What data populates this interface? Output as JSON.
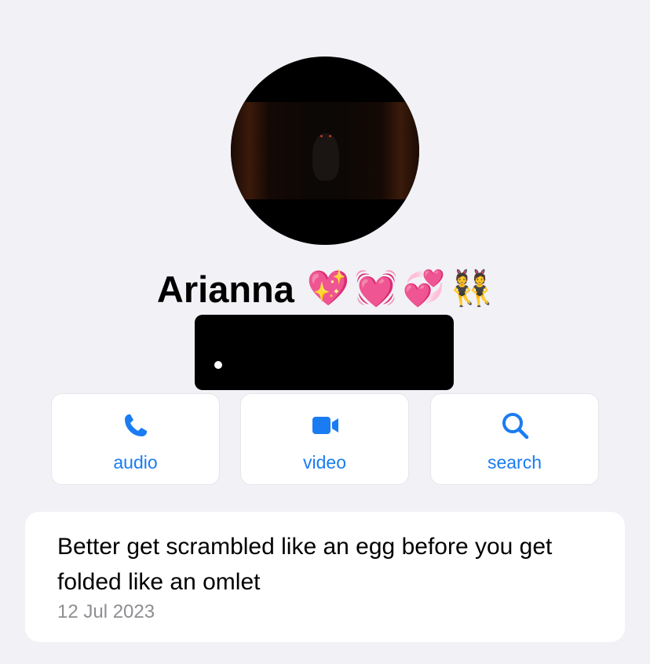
{
  "profile": {
    "name": "Arianna",
    "emojis": [
      "💖",
      "💓",
      "💞",
      "👯"
    ]
  },
  "actions": [
    {
      "label": "audio",
      "icon": "phone-icon"
    },
    {
      "label": "video",
      "icon": "video-camera-icon"
    },
    {
      "label": "search",
      "icon": "search-icon"
    }
  ],
  "status": {
    "text": "Better get scrambled like an egg before you get folded like an omlet",
    "date": "12 Jul 2023"
  },
  "colors": {
    "accent": "#1a7cf2",
    "background": "#f1f1f6",
    "card": "#ffffff",
    "secondary_text": "#8e8e93"
  }
}
